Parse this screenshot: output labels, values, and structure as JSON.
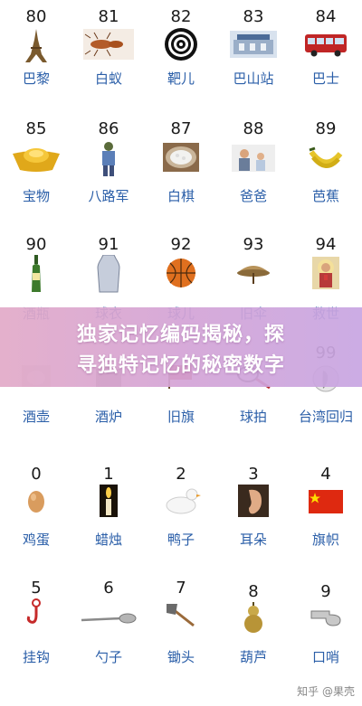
{
  "rows": [
    [
      {
        "number": "80",
        "label": "巴黎",
        "icon": "eiffel-tower-icon"
      },
      {
        "number": "81",
        "label": "白蚁",
        "icon": "termite-icon"
      },
      {
        "number": "82",
        "label": "靶儿",
        "icon": "target-icon"
      },
      {
        "number": "83",
        "label": "巴山站",
        "icon": "station-icon"
      },
      {
        "number": "84",
        "label": "巴士",
        "icon": "bus-icon"
      }
    ],
    [
      {
        "number": "85",
        "label": "宝物",
        "icon": "gold-ingot-icon"
      },
      {
        "number": "86",
        "label": "八路军",
        "icon": "soldier-icon"
      },
      {
        "number": "87",
        "label": "白棋",
        "icon": "go-stones-bowl-icon"
      },
      {
        "number": "88",
        "label": "爸爸",
        "icon": "father-icon"
      },
      {
        "number": "89",
        "label": "芭蕉",
        "icon": "banana-icon"
      }
    ],
    [
      {
        "number": "90",
        "label": "酒瓶",
        "icon": "wine-bottle-icon"
      },
      {
        "number": "91",
        "label": "球衣",
        "icon": "jersey-icon"
      },
      {
        "number": "92",
        "label": "球儿",
        "icon": "basketball-icon"
      },
      {
        "number": "93",
        "label": "旧伞",
        "icon": "old-umbrella-icon"
      },
      {
        "number": "94",
        "label": "救世",
        "icon": "savior-icon"
      }
    ],
    [
      {
        "number": "",
        "label": "酒壶",
        "icon": "wine-pot-icon"
      },
      {
        "number": "",
        "label": "酒炉",
        "icon": "stove-icon"
      },
      {
        "number": "",
        "label": "旧旗",
        "icon": "old-flag-icon"
      },
      {
        "number": "",
        "label": "球拍",
        "icon": "racket-icon"
      },
      {
        "number": "99",
        "label": "台湾回归",
        "icon": "taiwan-icon"
      }
    ],
    [
      {
        "number": "0",
        "label": "鸡蛋",
        "icon": "egg-icon"
      },
      {
        "number": "1",
        "label": "蜡烛",
        "icon": "candle-icon"
      },
      {
        "number": "2",
        "label": "鸭子",
        "icon": "duck-icon"
      },
      {
        "number": "3",
        "label": "耳朵",
        "icon": "ear-icon"
      },
      {
        "number": "4",
        "label": "旗帜",
        "icon": "flag-icon"
      }
    ],
    [
      {
        "number": "5",
        "label": "挂钩",
        "icon": "hook-icon"
      },
      {
        "number": "6",
        "label": "勺子",
        "icon": "spoon-icon"
      },
      {
        "number": "7",
        "label": "锄头",
        "icon": "hoe-icon"
      },
      {
        "number": "8",
        "label": "葫芦",
        "icon": "gourd-icon"
      },
      {
        "number": "9",
        "label": "口哨",
        "icon": "whistle-icon"
      }
    ]
  ],
  "banner": {
    "line1": "独家记忆编码揭秘，探",
    "line2": "寻独特记忆的秘密数字"
  },
  "watermark": "知乎 @果壳",
  "colors": {
    "label": "#2a5ea8",
    "number": "#1a1a1a",
    "banner_start": "#e2aac8",
    "banner_end": "#c8a6e2"
  }
}
